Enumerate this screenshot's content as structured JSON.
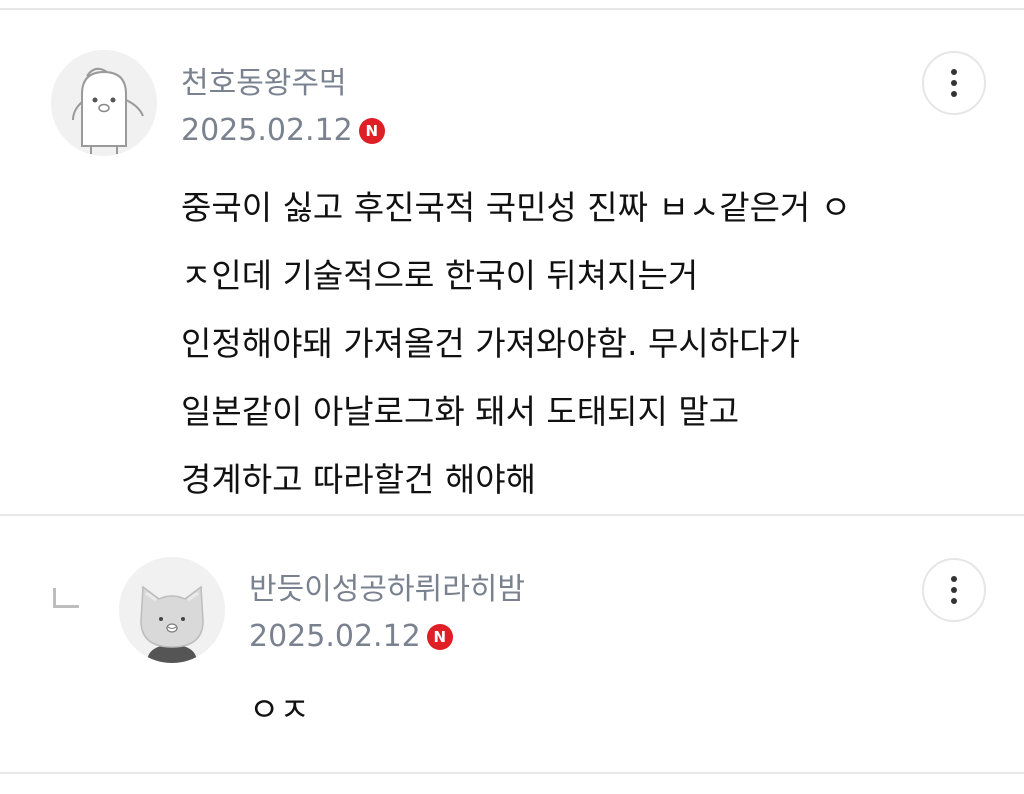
{
  "comments": [
    {
      "author": "천호동왕주먹",
      "date": "2025.02.12",
      "badge": "N",
      "lines": [
        "중국이 싫고 후진국적 국민성 진짜 ㅂㅅ같은거 ㅇ",
        "ㅈ인데 기술적으로 한국이 뒤쳐지는거",
        "인정해야돼 가져올건 가져와야함. 무시하다가",
        "일본같이 아날로그화 돼서 도태되지 말고",
        "경계하고 따라할건 해야해"
      ]
    },
    {
      "author": "반듯이성공하뤼라히밤",
      "date": "2025.02.12",
      "badge": "N",
      "lines": [
        "ㅇㅈ"
      ]
    }
  ],
  "colors": {
    "meta": "#7a8290",
    "body": "#111111",
    "badge": "#e01e26",
    "divider": "#e8e8e8"
  },
  "icons": {
    "more": "more-vertical-icon",
    "reply": "reply-indent-icon",
    "avatar1": "penguin-avatar",
    "avatar2": "cat-avatar"
  }
}
